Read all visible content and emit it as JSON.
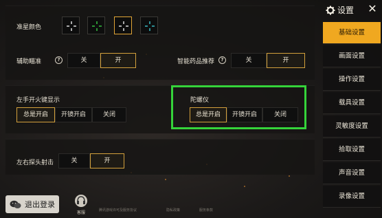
{
  "crosshair": {
    "label": "准星颜色",
    "swatches": [
      {
        "color": "#ffffff",
        "selected": false
      },
      {
        "color": "#3ddc4a",
        "selected": false
      },
      {
        "color": "#ffffff",
        "selected": true
      },
      {
        "color": "#3fd6e0",
        "selected": false
      }
    ]
  },
  "aim_assist": {
    "label": "辅助瞄准",
    "help": "?",
    "off": "关",
    "on": "开",
    "value": "开"
  },
  "smart_medicine": {
    "label": "智能药品推荐",
    "help": "?",
    "off": "关",
    "on": "开",
    "value": "开"
  },
  "left_fire": {
    "label": "左手开火键显示",
    "options": [
      "总是开启",
      "开镜开启",
      "关闭"
    ],
    "value": "总是开启"
  },
  "gyroscope": {
    "label": "陀螺仪",
    "options": [
      "总是开启",
      "开镜开启",
      "关闭"
    ],
    "value": "总是开启",
    "highlight_color": "#35d43a"
  },
  "lean_fire": {
    "label": "左右探头射击",
    "off": "关",
    "on": "开",
    "value": "开"
  },
  "sidebar": {
    "title": "设置",
    "close": "✕",
    "items": [
      {
        "label": "基础设置",
        "active": true
      },
      {
        "label": "画面设置",
        "active": false
      },
      {
        "label": "操作设置",
        "active": false
      },
      {
        "label": "载具设置",
        "active": false
      },
      {
        "label": "灵敏度设置",
        "active": false
      },
      {
        "label": "拾取设置",
        "active": false
      },
      {
        "label": "声音设置",
        "active": false
      },
      {
        "label": "录像设置",
        "active": false
      }
    ],
    "accent": "#f0a820"
  },
  "footer": {
    "logout": "退出登录",
    "service": "客服",
    "links": [
      "腾讯游戏许可及服务协议",
      "隐私政策",
      "服务条款"
    ]
  }
}
